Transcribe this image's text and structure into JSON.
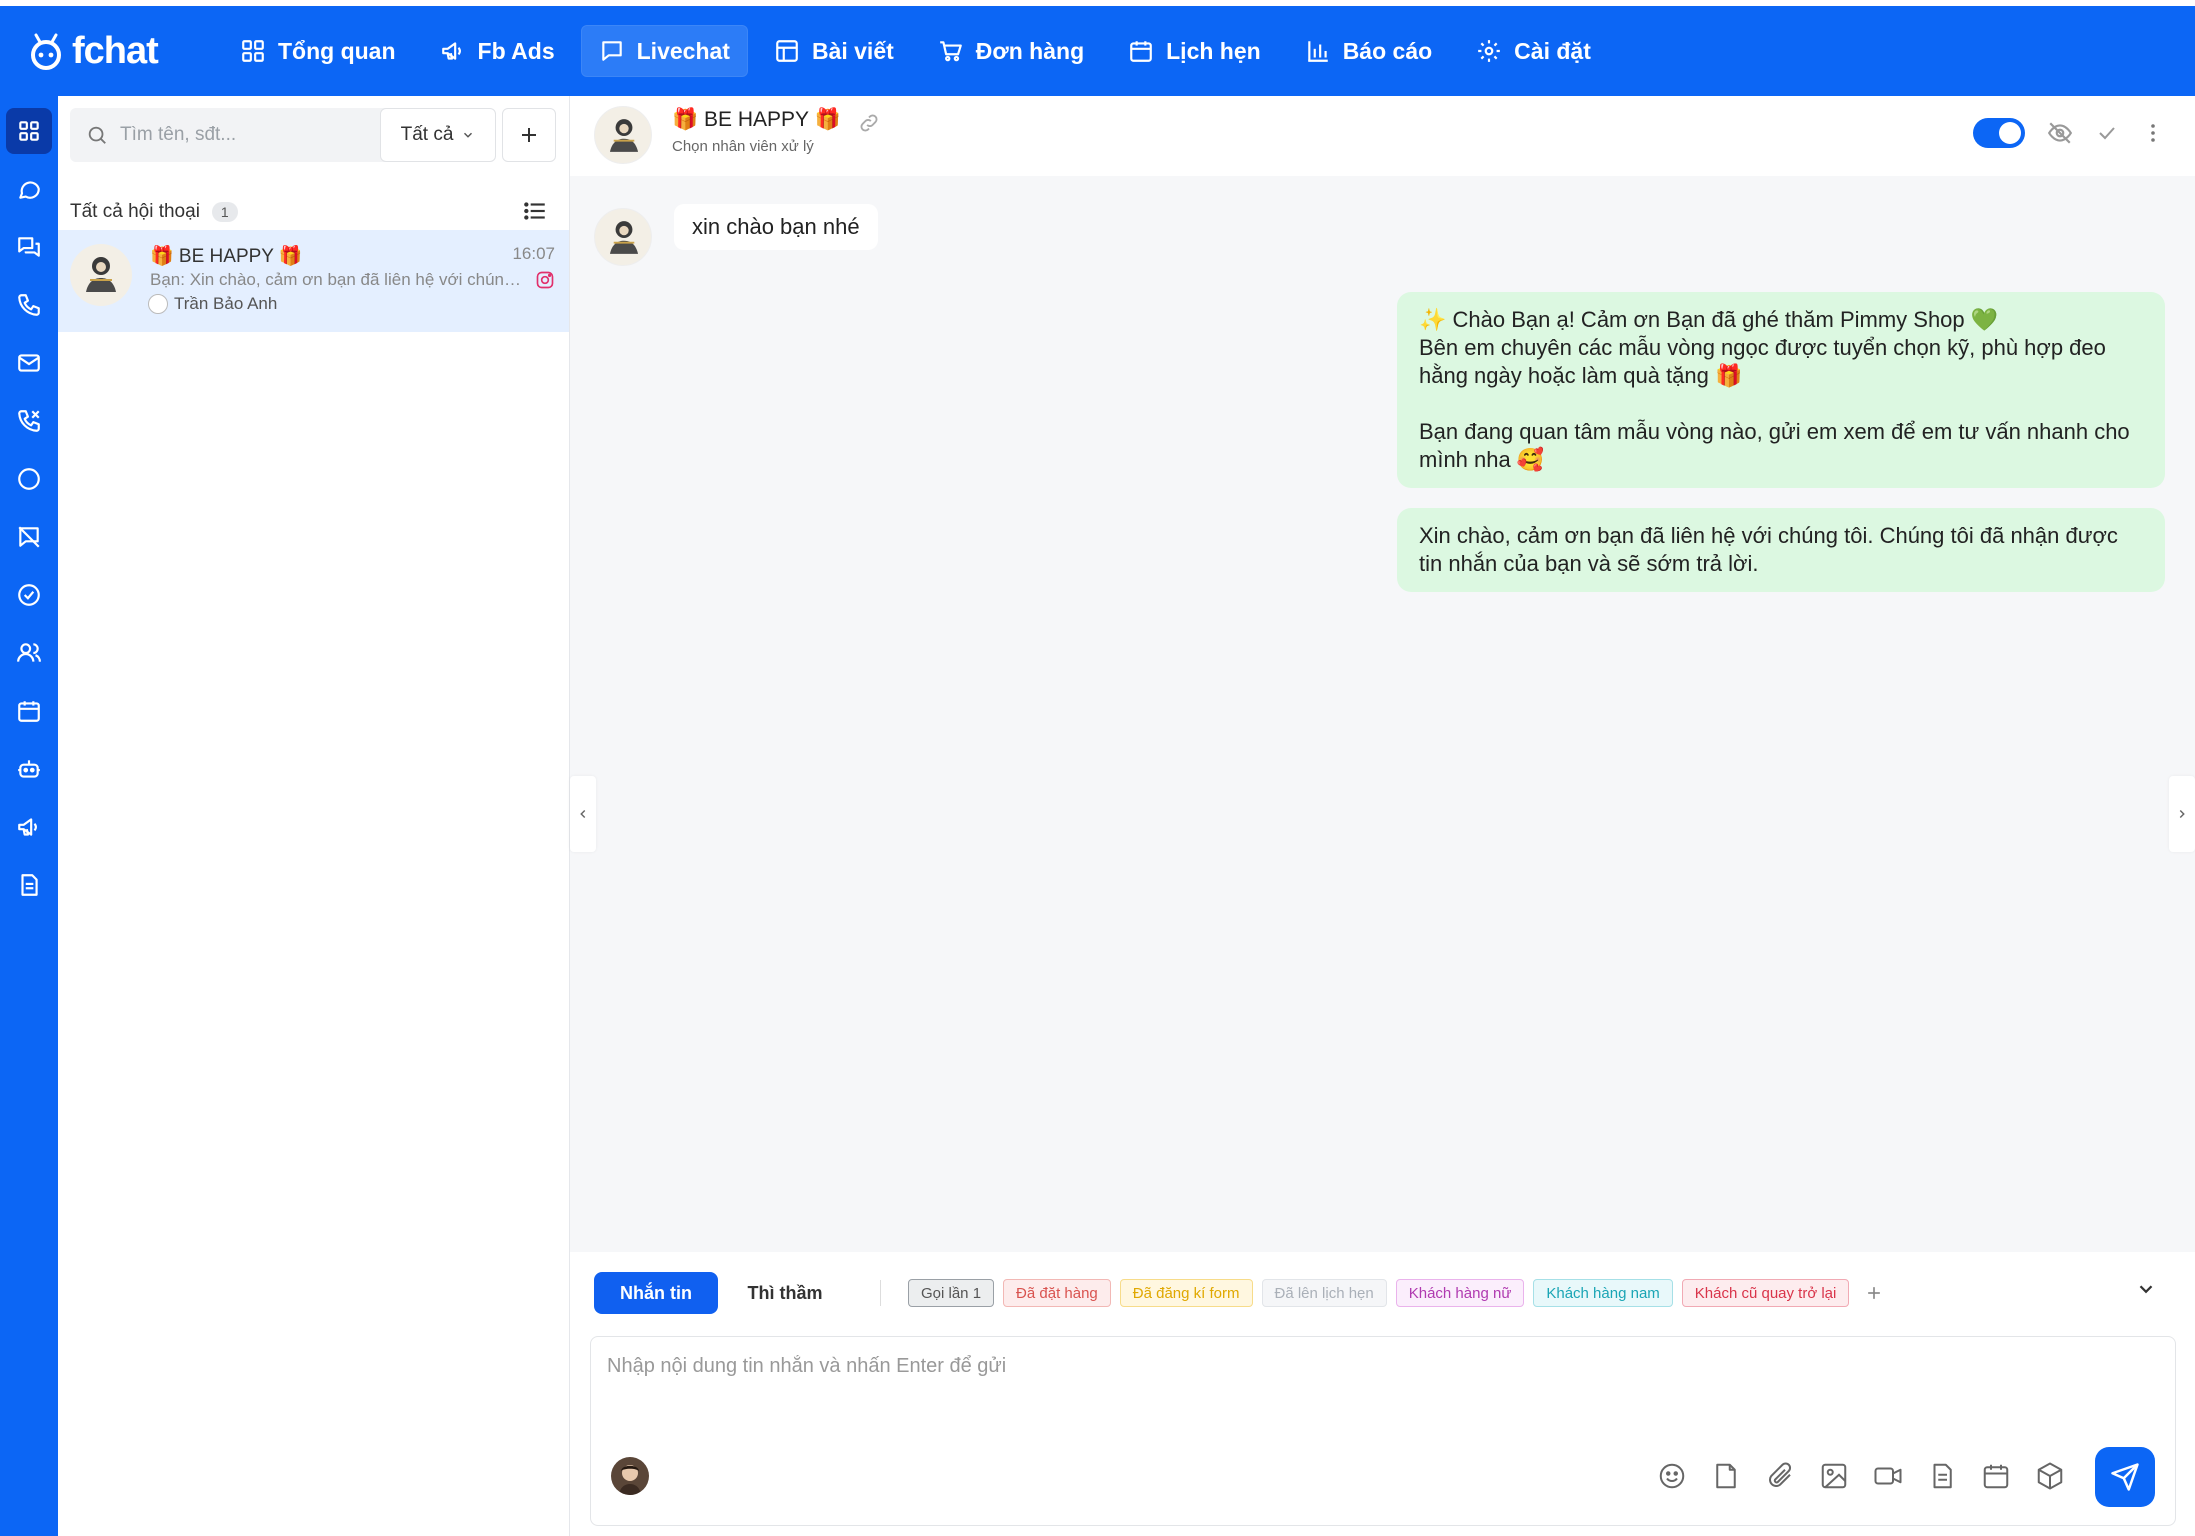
{
  "brand": {
    "name": "fchat"
  },
  "nav": {
    "items": [
      {
        "label": "Tổng quan",
        "icon": "dashboard-icon"
      },
      {
        "label": "Fb Ads",
        "icon": "megaphone-icon"
      },
      {
        "label": "Livechat",
        "icon": "chat-icon",
        "active": true
      },
      {
        "label": "Bài viết",
        "icon": "layout-icon"
      },
      {
        "label": "Đơn hàng",
        "icon": "cart-icon"
      },
      {
        "label": "Lịch hẹn",
        "icon": "calendar-icon"
      },
      {
        "label": "Báo cáo",
        "icon": "chart-icon"
      },
      {
        "label": "Cài đặt",
        "icon": "gear-icon"
      }
    ]
  },
  "rail": {
    "icons": [
      "grid-icon",
      "message-circle-icon",
      "messages-icon",
      "phone-icon",
      "mail-icon",
      "phone-call-icon",
      "circle-icon",
      "comment-off-icon",
      "check-circle-icon",
      "users-icon",
      "calendar-icon",
      "bot-icon",
      "megaphone-icon",
      "document-icon"
    ]
  },
  "list": {
    "search_placeholder": "Tìm tên, sđt...",
    "filter_label": "Tất cả",
    "title": "Tất cả hội thoại",
    "count": "1",
    "conversations": [
      {
        "name": "🎁 BE HAPPY 🎁",
        "time": "16:07",
        "preview": "Bạn: Xin chào, cảm ơn bạn đã liên hệ với chúng tôi. Chúng tôi đã nhận được tin nhắn",
        "agent": "Trần Bảo Anh",
        "channel": "instagram-icon"
      }
    ]
  },
  "chat": {
    "contact_name": "🎁 BE HAPPY 🎁",
    "assign_label": "Chọn nhân viên xử lý",
    "incoming": "xin chào bạn nhé",
    "outgoing": [
      "✨ Chào Bạn ạ! Cảm ơn Bạn đã ghé thăm Pimmy Shop 💚\nBên em chuyên các mẫu vòng ngọc được tuyển chọn kỹ, phù hợp đeo hằng ngày hoặc làm quà tặng 🎁\n\nBạn đang quan tâm mẫu vòng nào, gửi em xem để em tư vấn nhanh cho mình nha 🥰",
      "Xin chào, cảm ơn bạn đã liên hệ với chúng tôi. Chúng tôi đã nhận được tin nhắn của bạn và sẽ sớm trả lời."
    ]
  },
  "composer": {
    "tab_message": "Nhắn tin",
    "tab_note": "Thì thầm",
    "tags": [
      {
        "label": "Gọi lần 1",
        "color": "#555555",
        "bg": "#eceeef",
        "border": "#9aa0a6"
      },
      {
        "label": "Đã đặt hàng",
        "color": "#d9534f",
        "bg": "#fdecec",
        "border": "#f2b8b5"
      },
      {
        "label": "Đã đăng kí form",
        "color": "#e0a800",
        "bg": "#fff7e0",
        "border": "#f7dc8a"
      },
      {
        "label": "Đã lên lịch hẹn",
        "color": "#aab0b8",
        "bg": "#f5f6f8",
        "border": "#e2e5e9"
      },
      {
        "label": "Khách hàng nữ",
        "color": "#b03ab0",
        "bg": "#fbeefc",
        "border": "#eab3ec"
      },
      {
        "label": "Khách hàng nam",
        "color": "#1aa5b5",
        "bg": "#e8f8fa",
        "border": "#a6e0e7"
      },
      {
        "label": "Khách cũ quay trở lại",
        "color": "#d9344a",
        "bg": "#fdecee",
        "border": "#f1aab4"
      }
    ],
    "placeholder": "Nhập nội dung tin nhắn và nhấn Enter để gửi"
  },
  "colors": {
    "primary": "#0c66f5",
    "outgoing_bubble": "#dcf8e1",
    "selected_row": "#e4efff"
  }
}
